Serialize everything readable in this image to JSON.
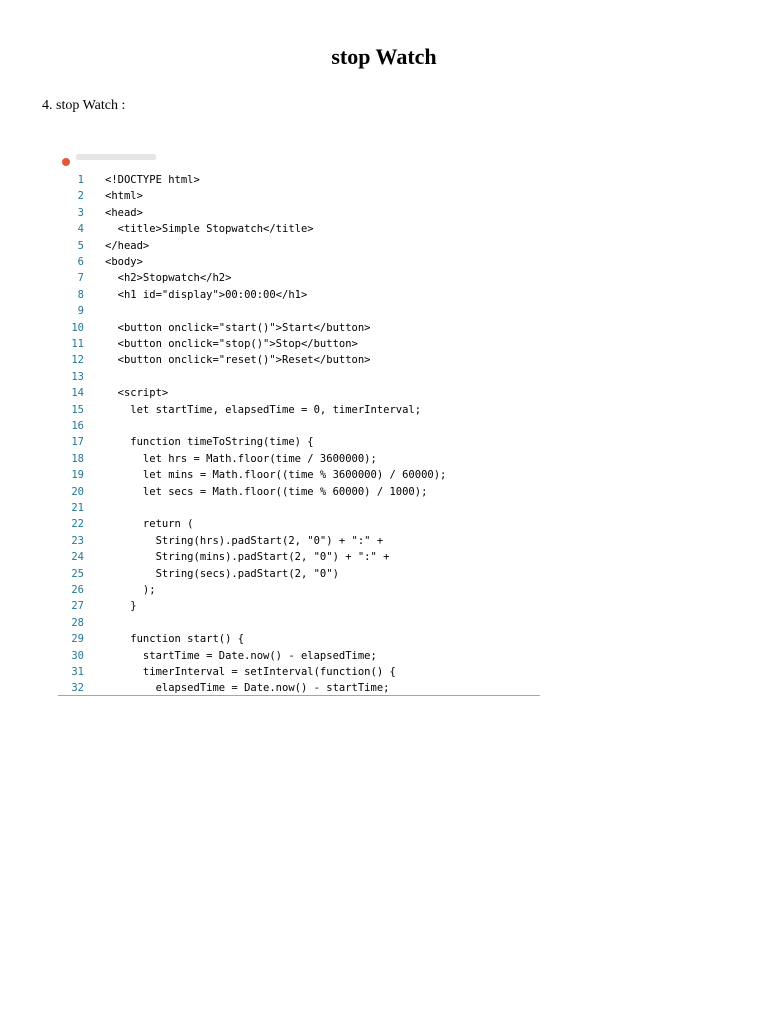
{
  "page": {
    "title": "stop Watch",
    "section_heading": "4. stop Watch :"
  },
  "code": {
    "lines": [
      {
        "n": "1",
        "text": "<!DOCTYPE html>"
      },
      {
        "n": "2",
        "text": "<html>"
      },
      {
        "n": "3",
        "text": "<head>"
      },
      {
        "n": "4",
        "text": "  <title>Simple Stopwatch</title>"
      },
      {
        "n": "5",
        "text": "</head>"
      },
      {
        "n": "6",
        "text": "<body>"
      },
      {
        "n": "7",
        "text": "  <h2>Stopwatch</h2>"
      },
      {
        "n": "8",
        "text": "  <h1 id=\"display\">00:00:00</h1>"
      },
      {
        "n": "9",
        "text": ""
      },
      {
        "n": "10",
        "text": "  <button onclick=\"start()\">Start</button>"
      },
      {
        "n": "11",
        "text": "  <button onclick=\"stop()\">Stop</button>"
      },
      {
        "n": "12",
        "text": "  <button onclick=\"reset()\">Reset</button>"
      },
      {
        "n": "13",
        "text": ""
      },
      {
        "n": "14",
        "text": "  <script>"
      },
      {
        "n": "15",
        "text": "    let startTime, elapsedTime = 0, timerInterval;"
      },
      {
        "n": "16",
        "text": ""
      },
      {
        "n": "17",
        "text": "    function timeToString(time) {"
      },
      {
        "n": "18",
        "text": "      let hrs = Math.floor(time / 3600000);"
      },
      {
        "n": "19",
        "text": "      let mins = Math.floor((time % 3600000) / 60000);"
      },
      {
        "n": "20",
        "text": "      let secs = Math.floor((time % 60000) / 1000);"
      },
      {
        "n": "21",
        "text": ""
      },
      {
        "n": "22",
        "text": "      return ("
      },
      {
        "n": "23",
        "text": "        String(hrs).padStart(2, \"0\") + \":\" +"
      },
      {
        "n": "24",
        "text": "        String(mins).padStart(2, \"0\") + \":\" +"
      },
      {
        "n": "25",
        "text": "        String(secs).padStart(2, \"0\")"
      },
      {
        "n": "26",
        "text": "      );"
      },
      {
        "n": "27",
        "text": "    }"
      },
      {
        "n": "28",
        "text": ""
      },
      {
        "n": "29",
        "text": "    function start() {"
      },
      {
        "n": "30",
        "text": "      startTime = Date.now() - elapsedTime;"
      },
      {
        "n": "31",
        "text": "      timerInterval = setInterval(function() {"
      },
      {
        "n": "32",
        "text": "        elapsedTime = Date.now() - startTime;"
      }
    ]
  },
  "colors": {
    "line_number": "#237893",
    "text": "#000000",
    "rule": "#7ab0e0"
  }
}
